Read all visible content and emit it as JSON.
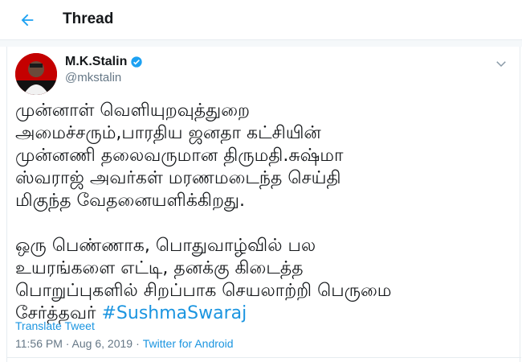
{
  "header": {
    "title": "Thread",
    "back_icon": "arrow-left-icon"
  },
  "tweet": {
    "author": {
      "display_name": "M.K.Stalin",
      "handle": "@mkstalin",
      "verified_icon": "verified-badge-icon"
    },
    "menu_icon": "chevron-down-icon",
    "body": {
      "paragraph1": "முன்னாள் வெளியுறவுத்துறை\nஅமைச்சரும்,பாரதிய ஜனதா கட்சியின்\nமுன்னணி தலைவருமான திருமதி.சுஷ்மா\nஸ்வராஜ் அவர்கள் மரணமடைந்த செய்தி\nமிகுந்த வேதனையளிக்கிறது.",
      "paragraph2": "ஒரு பெண்ணாக, பொதுவாழ்வில் பல\nஉயரங்களை எட்டி, தனக்கு கிடைத்த\nபொறுப்புகளில் சிறப்பாக செயலாற்றி பெருமை\nசேர்த்தவர் ",
      "hashtag": "#SushmaSwaraj"
    },
    "translate_label": "Translate Tweet",
    "timestamp": "11:56 PM · Aug 6, 2019",
    "separator": "·",
    "source": "Twitter for Android"
  },
  "colors": {
    "accent": "#1b95e0",
    "secondary_text": "#657786",
    "avatar_bg": "#c40000"
  }
}
